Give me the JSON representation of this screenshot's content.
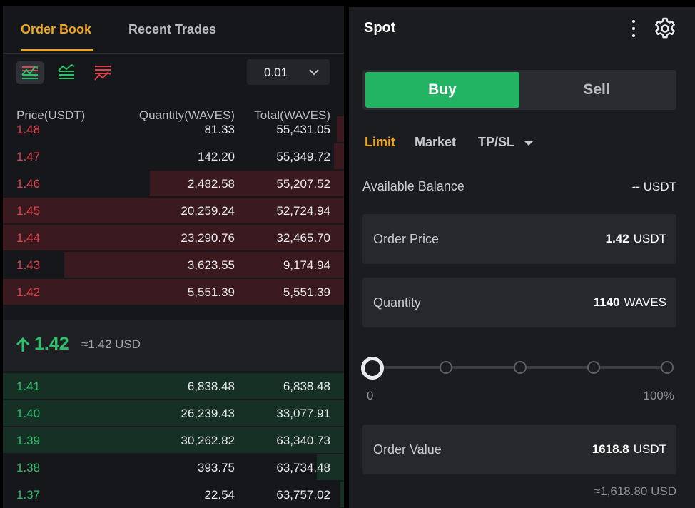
{
  "order_book": {
    "tabs": [
      "Order Book",
      "Recent Trades"
    ],
    "view_modes": [
      "both-sides-icon",
      "bids-only-icon",
      "asks-only-icon"
    ],
    "precision": "0.01",
    "columns": [
      "Price(USDT)",
      "Quantity(WAVES)",
      "Total(WAVES)"
    ],
    "asks": [
      {
        "price": "1.48",
        "qty": "81.33",
        "total": "55,431.05",
        "depth": 0.02
      },
      {
        "price": "1.47",
        "qty": "142.20",
        "total": "55,349.72",
        "depth": 0.03
      },
      {
        "price": "1.46",
        "qty": "2,482.58",
        "total": "55,207.52",
        "depth": 0.57
      },
      {
        "price": "1.45",
        "qty": "20,259.24",
        "total": "52,724.94",
        "depth": 1.0
      },
      {
        "price": "1.44",
        "qty": "23,290.76",
        "total": "32,465.70",
        "depth": 1.0
      },
      {
        "price": "1.43",
        "qty": "3,623.55",
        "total": "9,174.94",
        "depth": 0.82
      },
      {
        "price": "1.42",
        "qty": "5,551.39",
        "total": "5,551.39",
        "depth": 1.0
      }
    ],
    "last_price": "1.42",
    "last_price_usd": "≈1.42 USD",
    "bids": [
      {
        "price": "1.41",
        "qty": "6,838.48",
        "total": "6,838.48",
        "depth": 1.0
      },
      {
        "price": "1.40",
        "qty": "26,239.43",
        "total": "33,077.91",
        "depth": 1.0
      },
      {
        "price": "1.39",
        "qty": "30,262.82",
        "total": "63,340.73",
        "depth": 1.0
      },
      {
        "price": "1.38",
        "qty": "393.75",
        "total": "63,734.48",
        "depth": 0.08
      },
      {
        "price": "1.37",
        "qty": "22.54",
        "total": "63,757.02",
        "depth": 0.01
      }
    ]
  },
  "trade": {
    "title": "Spot",
    "buy_label": "Buy",
    "sell_label": "Sell",
    "order_types": [
      "Limit",
      "Market",
      "TP/SL"
    ],
    "available_label": "Available Balance",
    "available_value": "-- USDT",
    "order_price": {
      "label": "Order Price",
      "value": "1.42",
      "unit": "USDT"
    },
    "quantity": {
      "label": "Quantity",
      "value": "1140",
      "unit": "WAVES"
    },
    "slider": {
      "min_label": "0",
      "max_label": "100%",
      "fraction": 0
    },
    "order_value": {
      "label": "Order Value",
      "value": "1618.8",
      "unit": "USDT"
    },
    "order_value_approx": "≈1,618.80 USD"
  },
  "colors": {
    "accent": "#f0a522",
    "buy": "#22b463",
    "ask": "#e0424e",
    "bid": "#2cc06b"
  }
}
